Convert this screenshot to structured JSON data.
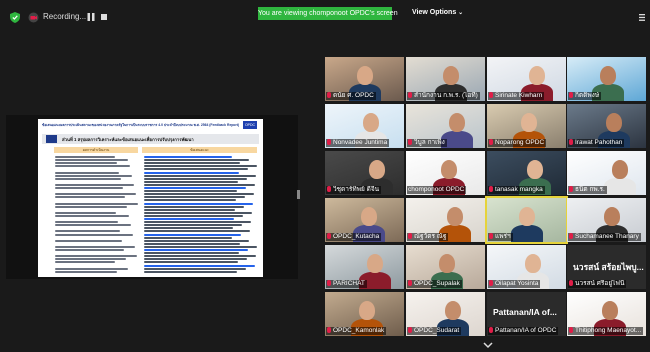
{
  "topbar": {
    "recording_label": "Recording...",
    "viewing_banner": "You are viewing chomponoot OPDC's screen",
    "view_options_label": "View Options",
    "accent": "#2fb63f"
  },
  "slide": {
    "title": "ข้อเสนอแนะผลการประเมินสถานะของหน่วยงานภาครัฐในการเป็นระบบราชการ 4.0 ประจำปีงบประมาณ พ.ศ. 2564 (Feedback Report)",
    "subtitle": "ส่วนที่ 1 สรุปผลการวิเคราะห์และข้อเสนอแนะเพื่อการปรับปรุงการพัฒนา",
    "col_left": "ผลการดำเนินงาน",
    "col_right": "ข้อเสนอแนะ",
    "logo": "OPDC"
  },
  "participants": [
    {
      "name": "ดนัย ศ. OPDC",
      "muted": true
    },
    {
      "name": "สำนักงาน ก.พ.ร. (ไอที)",
      "muted": true
    },
    {
      "name": "Sirinate Kiwharn",
      "muted": true
    },
    {
      "name": "กิตติพงษ์",
      "muted": true
    },
    {
      "name": "Nonvadee Juntima",
      "muted": true
    },
    {
      "name": "วิบูล กาเพิ่ง",
      "muted": true
    },
    {
      "name": "Noparong OPDC",
      "muted": true
    },
    {
      "name": "Irawat Pahothan",
      "muted": true
    },
    {
      "name": "วิชุดาร์ทิพย์ ดีจีน",
      "muted": true
    },
    {
      "name": "chomponoot OPDC",
      "muted": false
    },
    {
      "name": "tanasak mangka",
      "muted": true
    },
    {
      "name": "ธนิต กพ.ร.",
      "muted": true
    },
    {
      "name": "OPDC_Kutacha",
      "muted": true
    },
    {
      "name": "ณัฐวัตร ณัฐ",
      "muted": true
    },
    {
      "name": "แพร่ฯ",
      "muted": true
    },
    {
      "name": "Suchamanee Thanary",
      "muted": true
    },
    {
      "name": "PARICHAT",
      "muted": true
    },
    {
      "name": "OPDC_Supalak",
      "muted": true
    },
    {
      "name": "Oilapat Yosinta",
      "muted": true
    },
    {
      "name": "นวรสน์ ศรีอยู่ไฟนี้",
      "muted": true,
      "big": "นวรสน์ สร้อยไพบู..."
    },
    {
      "name": "OPDC_Kamonlak",
      "muted": true
    },
    {
      "name": "OPDC_Sudarat",
      "muted": true
    },
    {
      "name": "Pattanan/IA of OPDC",
      "muted": true,
      "big": "Pattanan/IA of..."
    },
    {
      "name": "Thitiphong Maenayot...",
      "muted": true
    }
  ]
}
